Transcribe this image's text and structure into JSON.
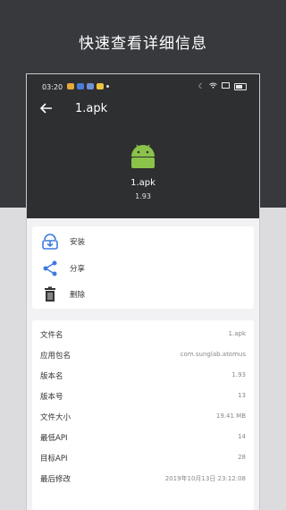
{
  "promo": {
    "title": "快速查看详细信息"
  },
  "statusbar": {
    "time": "03:20",
    "notif_colors": [
      "#e7a93a",
      "#4a7bd6",
      "#6f8fd6",
      "#f0c43c"
    ]
  },
  "toolbar": {
    "title": "1.apk"
  },
  "app": {
    "name": "1.apk",
    "version": "1.93",
    "icon_color": "#8bc34a"
  },
  "actions": [
    {
      "label": "安装",
      "icon": "install-icon"
    },
    {
      "label": "分享",
      "icon": "share-icon"
    },
    {
      "label": "删除",
      "icon": "delete-icon"
    }
  ],
  "info": [
    {
      "key": "文件名",
      "value": "1.apk"
    },
    {
      "key": "应用包名",
      "value": "com.sunglab.atomus"
    },
    {
      "key": "版本名",
      "value": "1.93"
    },
    {
      "key": "版本号",
      "value": "13"
    },
    {
      "key": "文件大小",
      "value": "19.41 MB"
    },
    {
      "key": "最低API",
      "value": "14"
    },
    {
      "key": "目标API",
      "value": "28"
    },
    {
      "key": "最后修改",
      "value": "2019年10月13日 23:12:08"
    }
  ],
  "colors": {
    "accent": "#3d7be0",
    "header": "#2e2f31",
    "background": "#37393d"
  }
}
